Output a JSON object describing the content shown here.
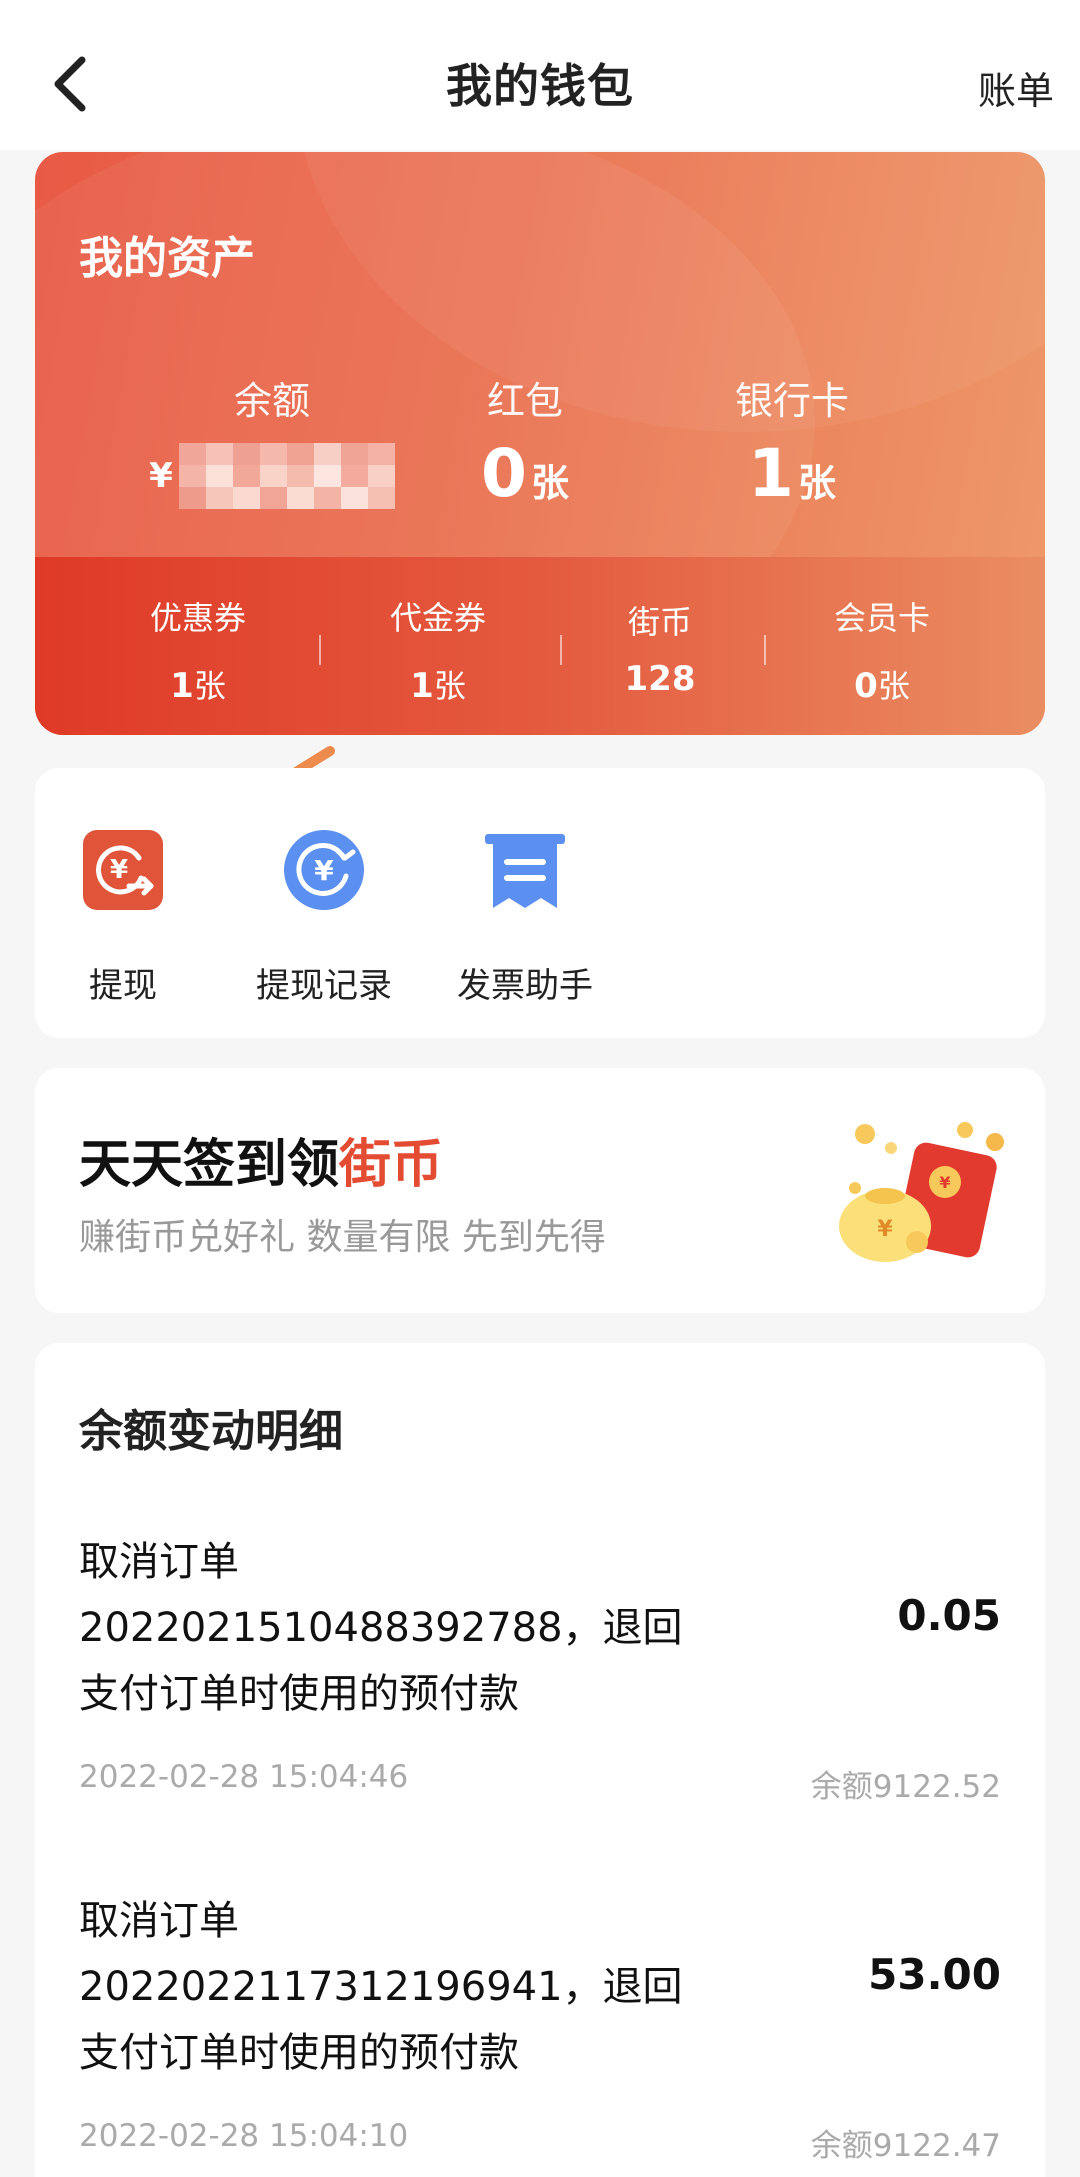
{
  "header": {
    "title": "我的钱包",
    "bill_link": "账单"
  },
  "assets": {
    "title": "我的资产",
    "balance": {
      "label": "余额",
      "currency": "¥"
    },
    "red_packet": {
      "label": "红包",
      "count": "0",
      "unit": "张"
    },
    "bank_card": {
      "label": "银行卡",
      "count": "1",
      "unit": "张"
    },
    "sub_items": [
      {
        "label": "优惠券",
        "count": "1",
        "unit": "张"
      },
      {
        "label": "代金券",
        "count": "1",
        "unit": "张"
      },
      {
        "label": "街币",
        "count": "128",
        "unit": ""
      },
      {
        "label": "会员卡",
        "count": "0",
        "unit": "张"
      }
    ]
  },
  "quick_actions": [
    {
      "label": "提现",
      "icon": "withdraw-icon"
    },
    {
      "label": "提现记录",
      "icon": "withdraw-record-icon"
    },
    {
      "label": "发票助手",
      "icon": "invoice-icon"
    }
  ],
  "checkin": {
    "title_main": "天天签到领",
    "title_highlight": "街币",
    "subtitle": "赚街币兑好礼 数量有限 先到先得",
    "icon": "red-envelope-gift-icon"
  },
  "details": {
    "title": "余额变动明细",
    "transactions": [
      {
        "line1": "取消订单",
        "line2": "2022021510488392788，退回",
        "line3": "支付订单时使用的预付款",
        "amount": "0.05",
        "time": "2022-02-28 15:04:46",
        "balance": "余额9122.52"
      },
      {
        "line1": "取消订单",
        "line2": "2022022117312196941，退回",
        "line3": "支付订单时使用的预付款",
        "amount": "53.00",
        "time": "2022-02-28 15:04:10",
        "balance": "余额9122.47"
      }
    ]
  },
  "colors": {
    "accent": "#e34b32",
    "card_gradient_start": "#e85a45",
    "card_gradient_end": "#ee9a6a",
    "withdraw_icon": "#e0553a",
    "record_icon": "#5b8ff0",
    "invoice_icon": "#5b8ff0"
  }
}
